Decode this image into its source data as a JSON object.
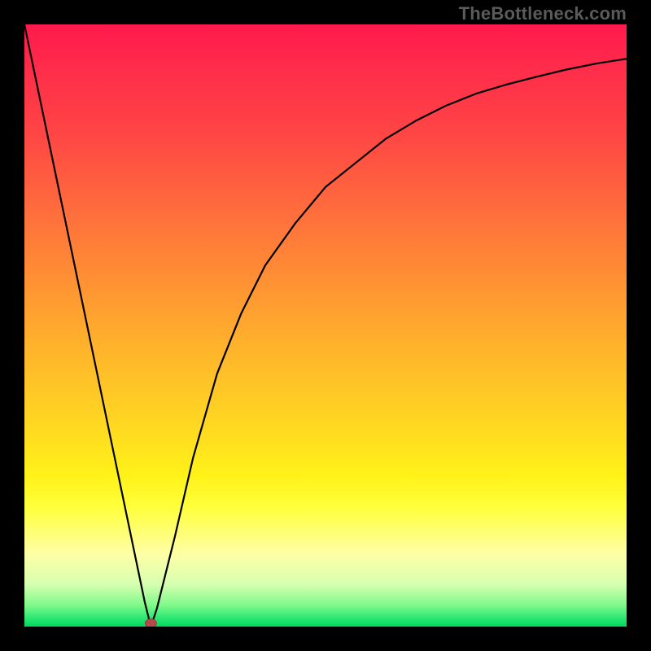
{
  "watermark": {
    "text": "TheBottleneck.com"
  },
  "chart_data": {
    "type": "line",
    "title": "",
    "xlabel": "",
    "ylabel": "",
    "xlim": [
      0,
      100
    ],
    "ylim": [
      0,
      100
    ],
    "grid": false,
    "legend": false,
    "background_gradient": {
      "direction": "top-to-bottom",
      "stops": [
        {
          "pos": 0,
          "color": "#ff1a4d"
        },
        {
          "pos": 0.3,
          "color": "#ff6a3d"
        },
        {
          "pos": 0.55,
          "color": "#ffb42b"
        },
        {
          "pos": 0.78,
          "color": "#fff219"
        },
        {
          "pos": 0.94,
          "color": "#d6ffb0"
        },
        {
          "pos": 1.0,
          "color": "#00d860"
        }
      ]
    },
    "marker": {
      "x": 21,
      "y": 0,
      "color": "#b54a4a",
      "size": 8
    },
    "series": [
      {
        "name": "curve",
        "color": "#000000",
        "x": [
          0,
          5,
          10,
          15,
          20,
          21,
          22,
          25,
          28,
          32,
          36,
          40,
          45,
          50,
          55,
          60,
          65,
          70,
          75,
          80,
          85,
          90,
          95,
          100
        ],
        "y": [
          100,
          76,
          52,
          28,
          4,
          0,
          3,
          15,
          28,
          42,
          52,
          60,
          67,
          73,
          77,
          81,
          84,
          86.5,
          88.5,
          90,
          91.3,
          92.5,
          93.5,
          94.3
        ]
      }
    ]
  }
}
